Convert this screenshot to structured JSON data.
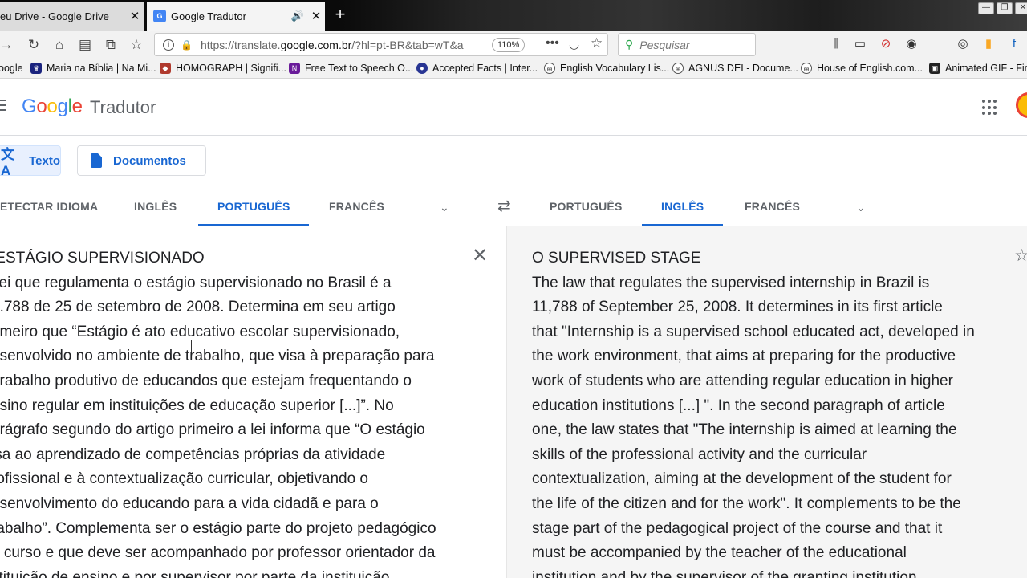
{
  "browser": {
    "tabs": [
      {
        "title": "eu Drive - Google Drive",
        "close": "✕"
      },
      {
        "title": "Google Tradutor",
        "close": "✕"
      }
    ],
    "url": {
      "prefix": "https://translate.",
      "domain": "google.com.br",
      "suffix": "/?hl=pt-BR&tab=wT&a"
    },
    "zoom": "110%",
    "search_placeholder": "Pesquisar",
    "bookmarks": [
      "oogle",
      "Maria na Bíblia | Na Mi...",
      "HOMOGRAPH | Signifi...",
      "Free Text to Speech O...",
      "Accepted Facts | Inter...",
      "English Vocabulary Lis...",
      "AGNUS DEI - Docume...",
      "House of English.com...",
      "Animated GIF - Fin"
    ]
  },
  "app": {
    "logo": "Google",
    "product": "Tradutor",
    "modes": {
      "text": "Texto",
      "documents": "Documentos"
    },
    "source_langs": [
      "ETECTAR IDIOMA",
      "INGLÊS",
      "PORTUGUÊS",
      "FRANCÊS"
    ],
    "target_langs": [
      "PORTUGUÊS",
      "INGLÊS",
      "FRANCÊS"
    ],
    "source_active": "PORTUGUÊS",
    "target_active": "INGLÊS",
    "source_text": " ESTÁGIO SUPERVISIONADO\n lei que regulamenta o estágio supervisionado no Brasil é a\n1.788 de 25 de setembro de 2008. Determina em seu artigo\nrimeiro que “Estágio é ato educativo escolar supervisionado,\nesenvolvido no ambiente de trabalho, que visa à preparação para\n trabalho produtivo de educandos que estejam frequentando o\nnsino regular em instituições de educação superior [...]”. No\narágrafo segundo do artigo primeiro a lei informa que “O estágio\nisa ao aprendizado de competências próprias da atividade\nrofissional e à contextualização curricular, objetivando o\nesenvolvimento do educando para a vida cidadã e para o\nrabalho”. Complementa ser o estágio parte do projeto pedagógico\no curso e que deve ser acompanhado por professor orientador da\nstituição de ensino e por supervisor por parte da instituição",
    "target_text": "O SUPERVISED STAGE\nThe law that regulates the supervised internship in Brazil is\n11,788 of September 25, 2008. It determines in its first article\nthat \"Internship is a supervised school educated act, developed in\nthe work environment, that aims at preparing for the productive\nwork of students who are attending regular education in higher\neducation institutions [...] \". In the second paragraph of article\none, the law states that \"The internship is aimed at learning the\nskills of the professional activity and the curricular\ncontextualization, aiming at the development of the student for\nthe life of the citizen and for the work\". It complements to be the\nstage part of the pedagogical project of the course and that it\nmust be accompanied by the teacher of the educational\ninstitution and by the supervisor of the granting institution"
  },
  "colors": {
    "accent": "#1967d2",
    "google_blue": "#4285f4",
    "google_red": "#ea4335",
    "google_yellow": "#fbbc05",
    "google_green": "#34a853"
  }
}
